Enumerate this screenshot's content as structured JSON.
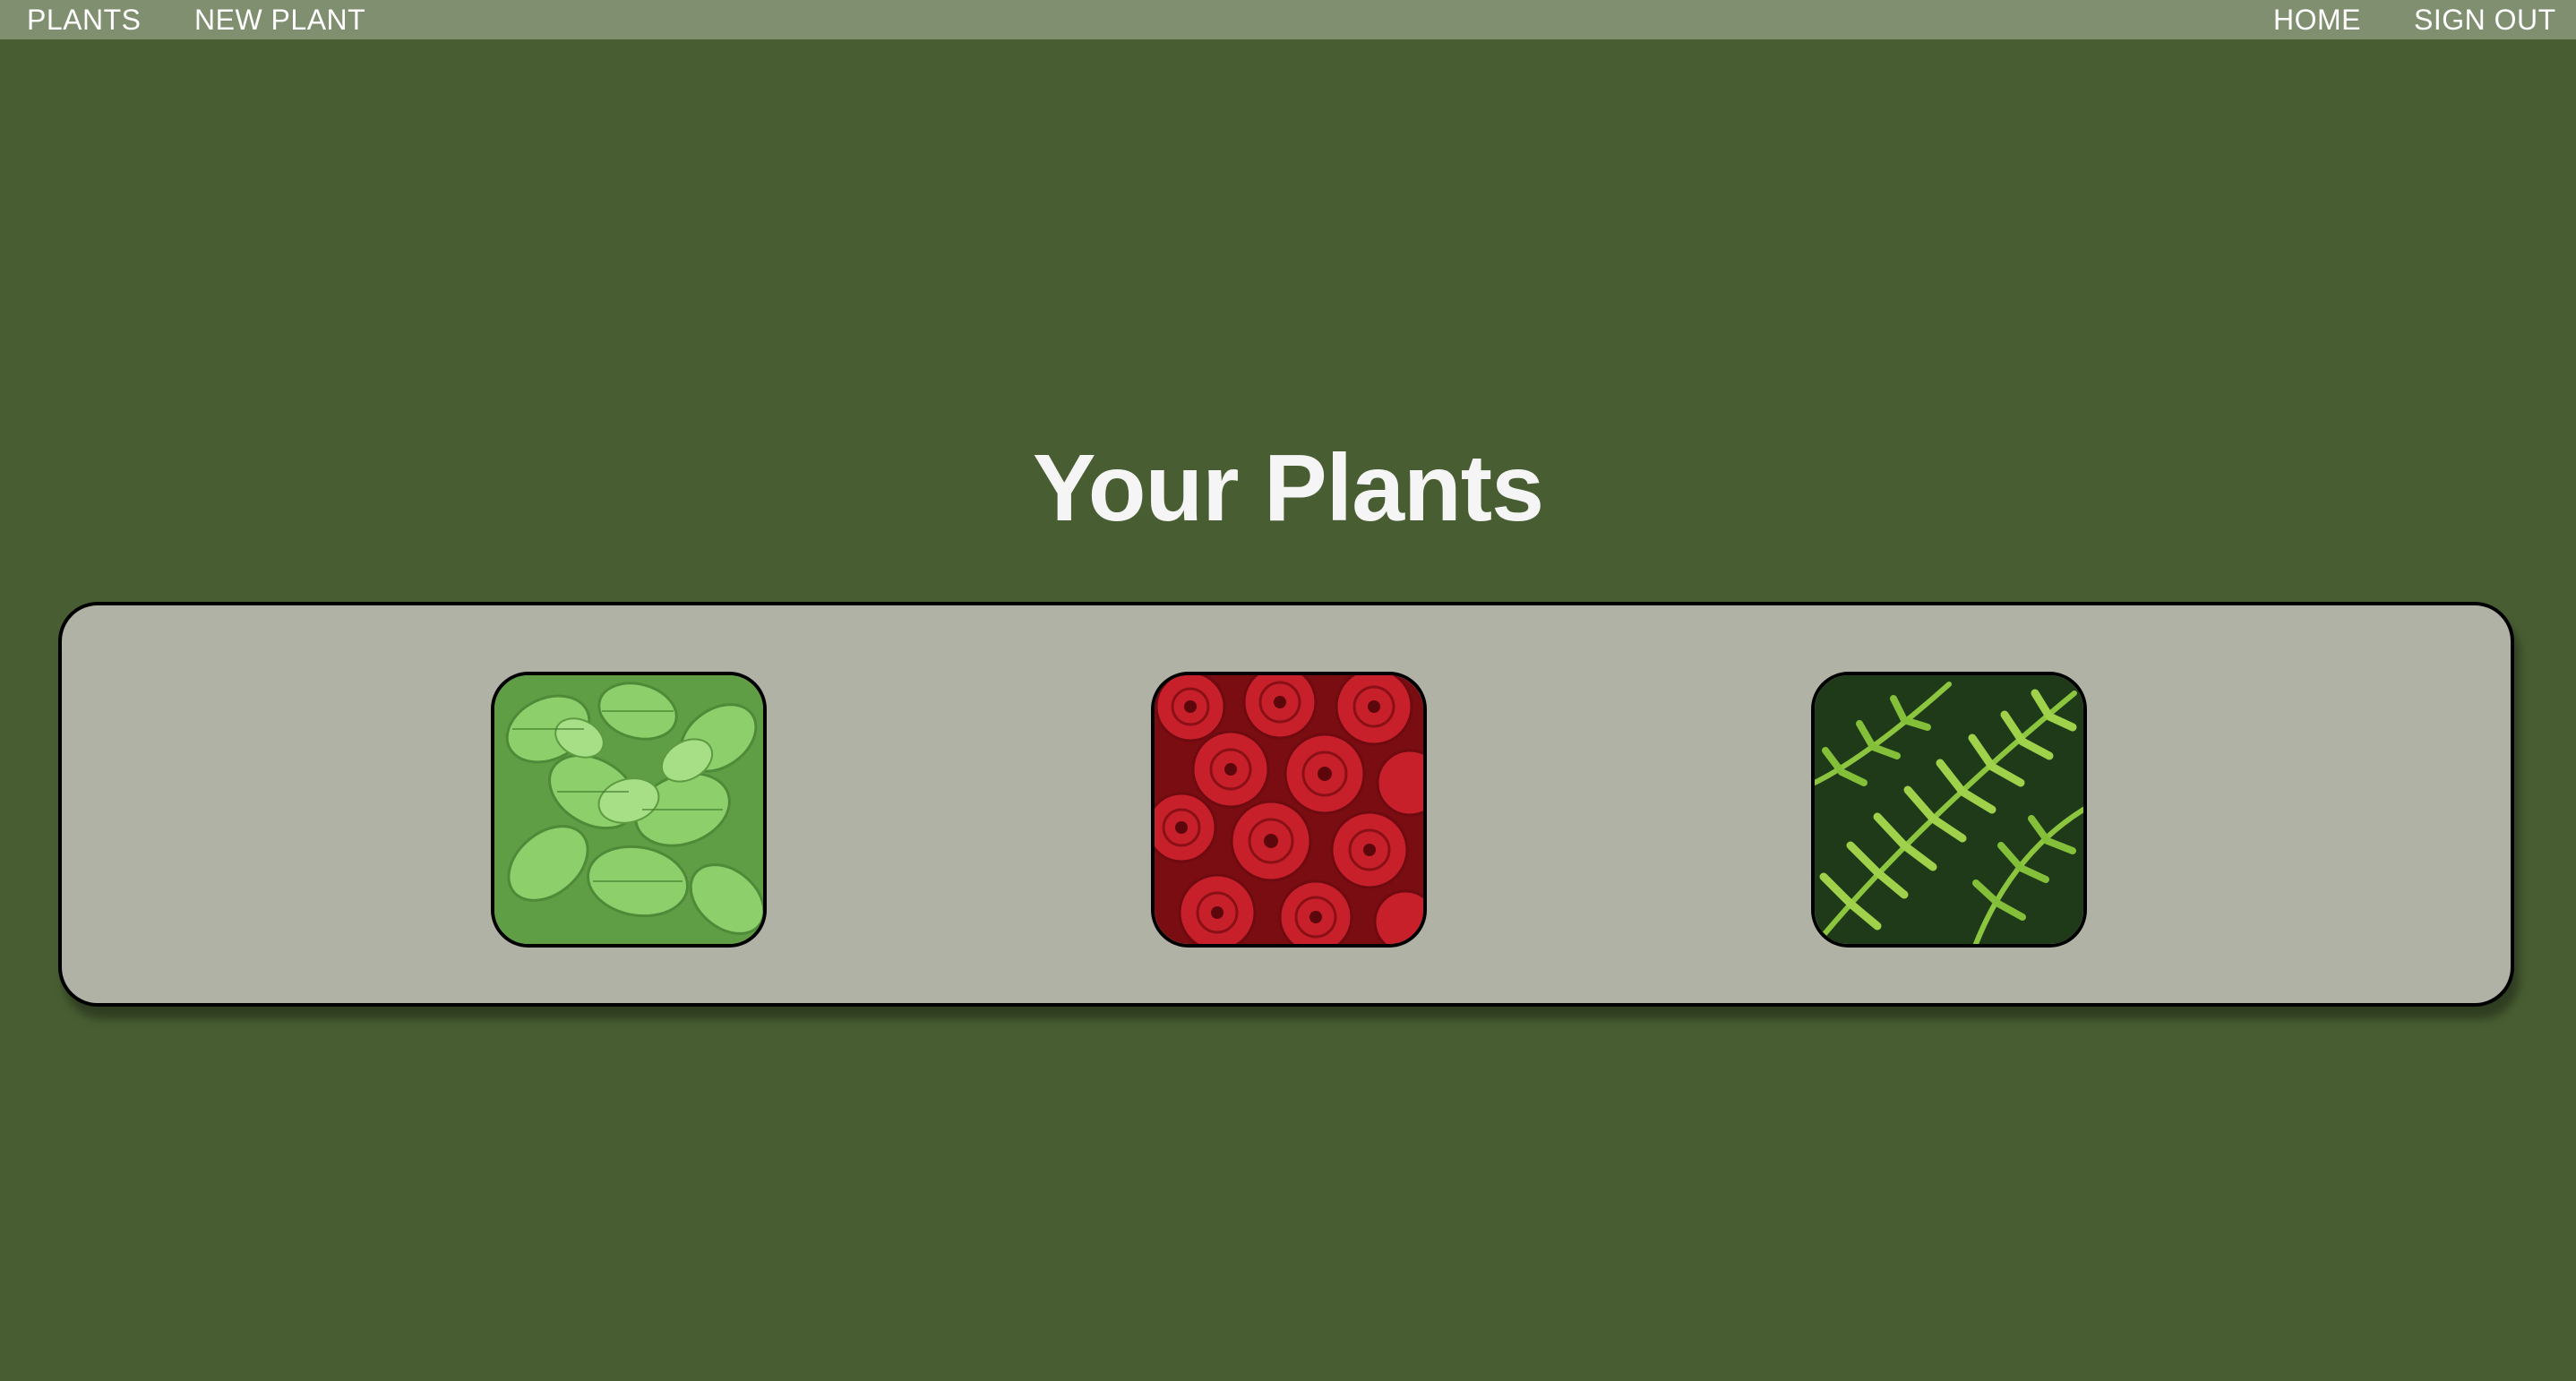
{
  "nav": {
    "left": [
      "PLANTS",
      "NEW PLANT"
    ],
    "right": [
      "HOME",
      "SIGN OUT"
    ]
  },
  "main": {
    "title": "Your Plants",
    "plants": [
      {
        "image": "mint-leaves-photo"
      },
      {
        "image": "red-roses-photo"
      },
      {
        "image": "fern-fronds-photo"
      }
    ]
  },
  "colors": {
    "background": "#485e32",
    "navbar": "#7f8f6f",
    "panel": "#b0b2a6",
    "title": "#f5f5f5"
  }
}
